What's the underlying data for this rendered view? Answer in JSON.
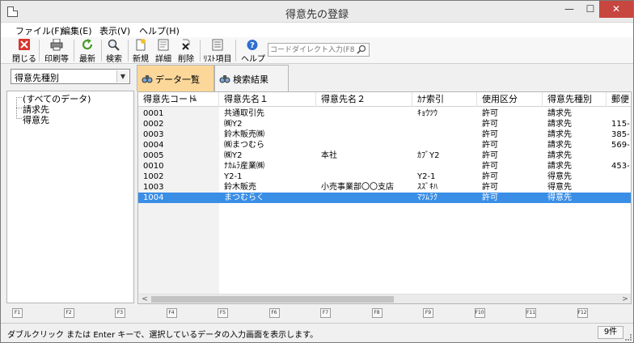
{
  "window": {
    "title": "得意先の登録"
  },
  "menu": [
    "ファイル(F)",
    "編集(E)",
    "表示(V)",
    "ヘルプ(H)"
  ],
  "toolbar": {
    "close_label": "閉じる",
    "print_label": "印刷等",
    "refresh_label": "最新",
    "search_label": "検索",
    "new_label": "新規",
    "detail_label": "詳細",
    "delete_label": "削除",
    "list_items_label": "ﾘｽﾄ項目",
    "help_label": "ヘルプ",
    "direct_input_placeholder": "コードダイレクト入力(F8)"
  },
  "left": {
    "type_select": "得意先種別",
    "tree": [
      "(すべてのデータ)",
      "請求先",
      "得意先"
    ]
  },
  "tabs": [
    "データ一覧",
    "検索結果"
  ],
  "grid": {
    "columns": [
      "得意先コード",
      "得意先名１",
      "得意先名２",
      "ｶﾅ索引",
      "使用区分",
      "得意先種別",
      "郵便"
    ],
    "rows": [
      [
        "0001",
        "共通取引先",
        "",
        "ｷｮｳﾂｳ",
        "許可",
        "請求先",
        ""
      ],
      [
        "0002",
        "㈱Y2",
        "",
        "",
        "許可",
        "請求先",
        "115-"
      ],
      [
        "0003",
        "鈴木販売㈱",
        "",
        "",
        "許可",
        "請求先",
        "385-"
      ],
      [
        "0004",
        "㈱まつむら",
        "",
        "",
        "許可",
        "請求先",
        "569-"
      ],
      [
        "0005",
        "㈱Y2",
        "本社",
        "ｶﾌﾞY2",
        "許可",
        "請求先",
        ""
      ],
      [
        "0010",
        "ﾅｶﾑﾗ産業㈱",
        "",
        "",
        "許可",
        "請求先",
        "453-"
      ],
      [
        "1002",
        "Y2-1",
        "",
        "Y2-1",
        "許可",
        "得意先",
        ""
      ],
      [
        "1003",
        "鈴木販売",
        "小売事業部〇〇支店",
        "ｽｽﾞｷﾊ",
        "許可",
        "得意先",
        ""
      ],
      [
        "1004",
        "まつむらく",
        "",
        "ﾏﾂﾑﾗｸ",
        "許可",
        "得意先",
        ""
      ]
    ],
    "selected_row": 8
  },
  "fkeys": [
    "F1",
    "F2",
    "F3",
    "F4",
    "F5",
    "F6",
    "F7",
    "F8",
    "F9",
    "F10",
    "F11",
    "F12"
  ],
  "status": {
    "message": "ダブルクリック または Enter キーで、選択しているデータの入力画面を表示します。",
    "count": "9件"
  }
}
